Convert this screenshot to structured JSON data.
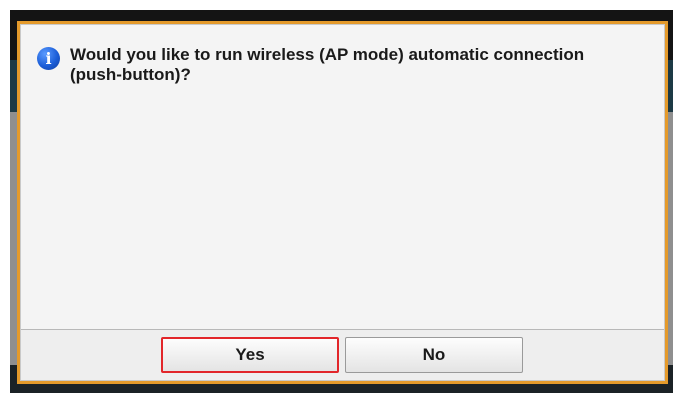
{
  "dialog": {
    "icon": "info-icon",
    "icon_glyph": "i",
    "message": "Would you like to run wireless (AP mode) automatic connection (push-button)?",
    "buttons": {
      "yes_label": "Yes",
      "no_label": "No"
    },
    "focused_button": "Yes"
  },
  "colors": {
    "dialog_border": "#e49a2b",
    "focus_outline": "#e2262a",
    "info_icon": "#1c5ed8"
  }
}
